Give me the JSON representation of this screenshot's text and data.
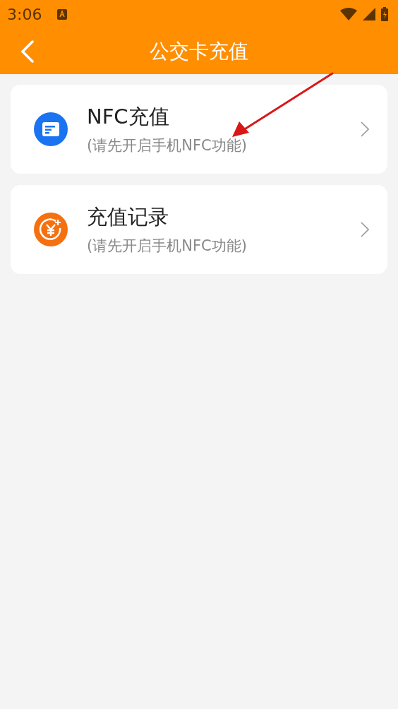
{
  "status_bar": {
    "time": "3:06"
  },
  "header": {
    "title": "公交卡充值"
  },
  "items": [
    {
      "kind": "card",
      "color": "#1a73f0",
      "title": "NFC充值",
      "subtitle": "(请先开启手机NFC功能)"
    },
    {
      "kind": "yen",
      "color": "#f5700f",
      "title": "充值记录",
      "subtitle": "(请先开启手机NFC功能)"
    }
  ]
}
